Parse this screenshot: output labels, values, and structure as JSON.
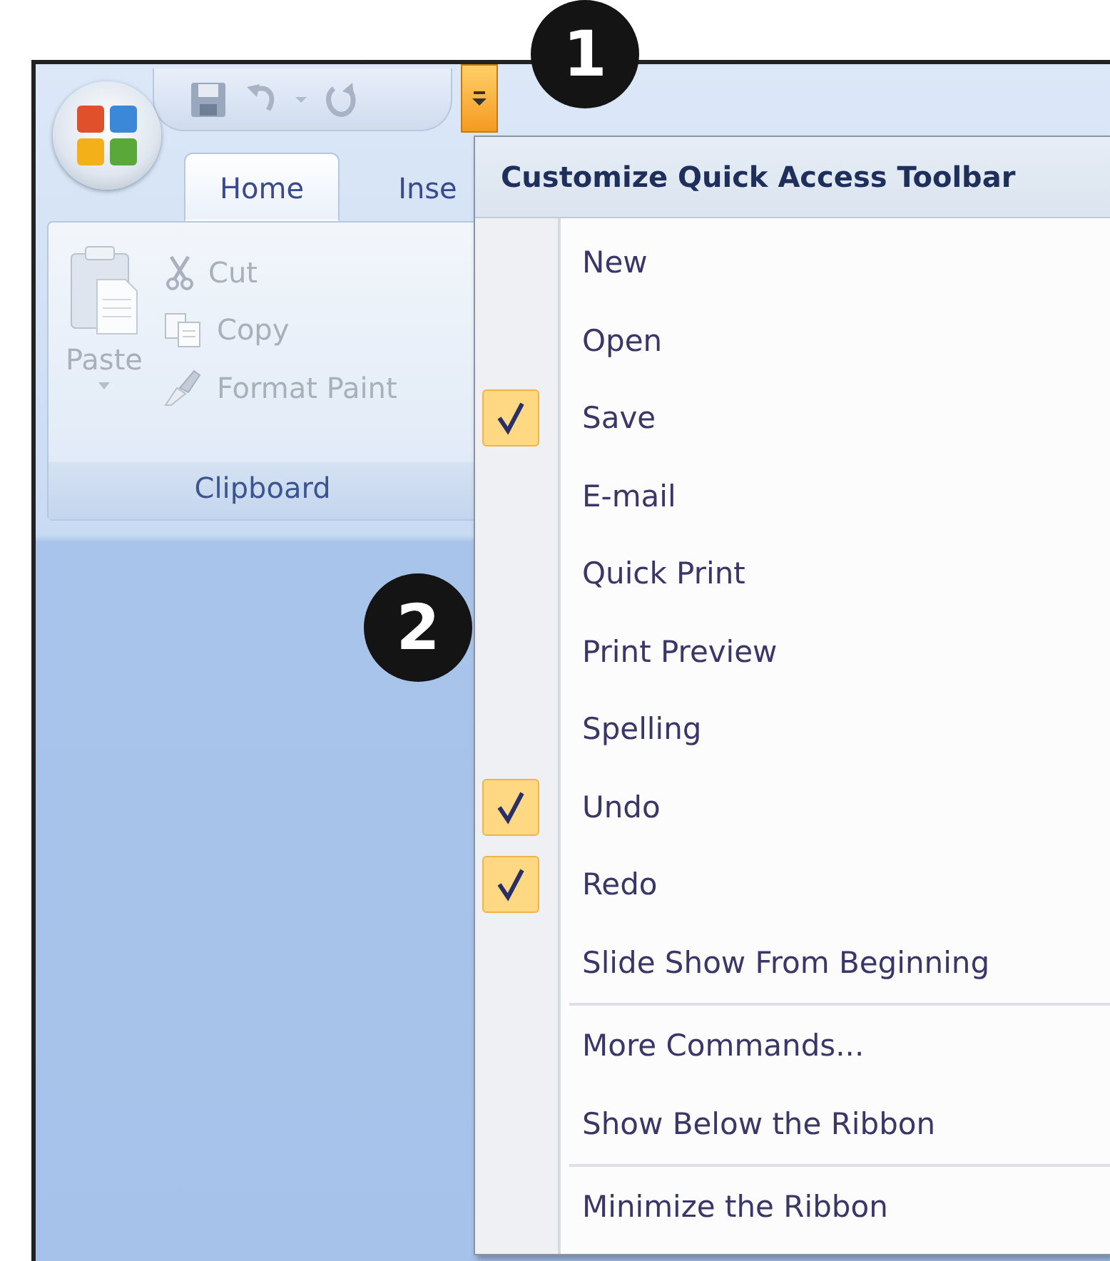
{
  "tabs": [
    {
      "label": "Home",
      "selected": true
    },
    {
      "label": "Inse",
      "selected": false
    }
  ],
  "ribbon_group": {
    "label": "Clipboard",
    "commands": [
      {
        "label": "Paste",
        "kind": "large",
        "disabled": true
      },
      {
        "label": "Cut",
        "kind": "cut",
        "disabled": true
      },
      {
        "label": "Copy",
        "kind": "copy",
        "disabled": true
      },
      {
        "label": "Format Paint",
        "kind": "brush",
        "disabled": true
      }
    ]
  },
  "menu": {
    "title": "Customize Quick Access Toolbar",
    "sections": [
      {
        "items": [
          {
            "label": "New",
            "checked": false
          },
          {
            "label": "Open",
            "checked": false
          },
          {
            "label": "Save",
            "checked": true
          },
          {
            "label": "E-mail",
            "checked": false
          },
          {
            "label": "Quick Print",
            "checked": false
          },
          {
            "label": "Print Preview",
            "checked": false
          },
          {
            "label": "Spelling",
            "checked": false
          },
          {
            "label": "Undo",
            "checked": true
          },
          {
            "label": "Redo",
            "checked": true
          },
          {
            "label": "Slide Show From Beginning",
            "checked": false
          }
        ]
      },
      {
        "items": [
          {
            "label": "More Commands...",
            "checked": false
          },
          {
            "label": "Show Below the Ribbon",
            "checked": false
          }
        ]
      },
      {
        "items": [
          {
            "label": "Minimize the Ribbon",
            "checked": false
          }
        ]
      }
    ]
  },
  "callouts": [
    {
      "label": "1"
    },
    {
      "label": "2"
    }
  ]
}
